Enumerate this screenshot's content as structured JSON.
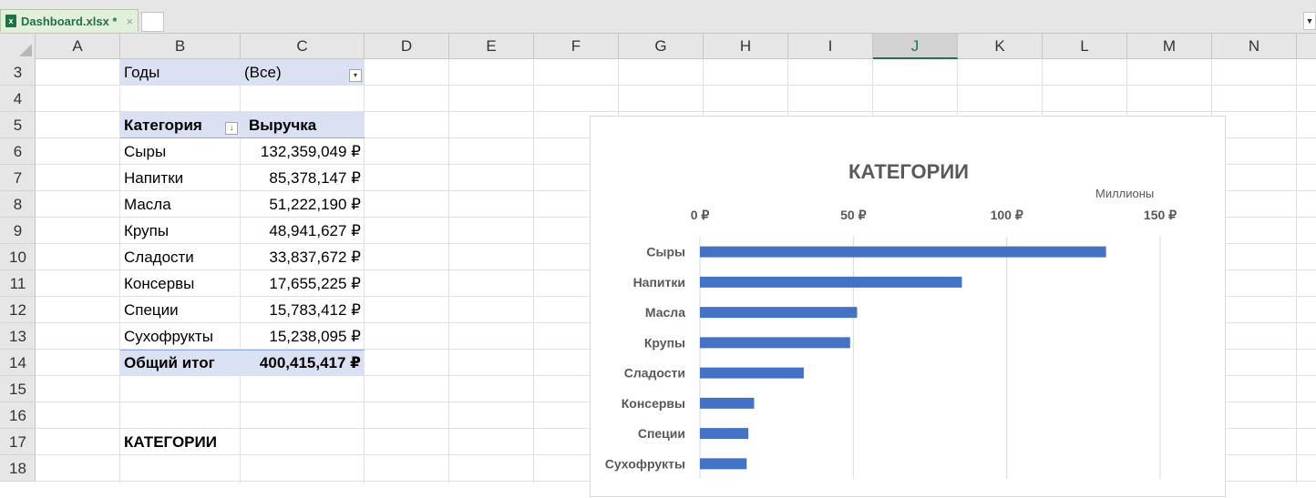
{
  "file_tab": {
    "name": "Dashboard.xlsx *",
    "icon": "excel-file-icon",
    "close": "×"
  },
  "columns": [
    "A",
    "B",
    "C",
    "D",
    "E",
    "F",
    "G",
    "H",
    "I",
    "J",
    "K",
    "L",
    "M",
    "N"
  ],
  "selected_column": "J",
  "rows": [
    "3",
    "4",
    "5",
    "6",
    "7",
    "8",
    "9",
    "10",
    "11",
    "12",
    "13",
    "14",
    "15",
    "16",
    "17",
    "18"
  ],
  "pivot": {
    "filter_label": "Годы",
    "filter_value": "(Все)",
    "header_category": "Категория",
    "header_revenue": "Выручка",
    "rows": [
      {
        "category": "Сыры",
        "revenue": "132,359,049 ₽"
      },
      {
        "category": "Напитки",
        "revenue": "85,378,147 ₽"
      },
      {
        "category": "Масла",
        "revenue": "51,222,190 ₽"
      },
      {
        "category": "Крупы",
        "revenue": "48,941,627 ₽"
      },
      {
        "category": "Сладости",
        "revenue": "33,837,672 ₽"
      },
      {
        "category": "Консервы",
        "revenue": "17,655,225 ₽"
      },
      {
        "category": "Специи",
        "revenue": "15,783,412 ₽"
      },
      {
        "category": "Сухофрукты",
        "revenue": "15,238,095 ₽"
      }
    ],
    "total_label": "Общий итог",
    "total_value": "400,415,417 ₽"
  },
  "section_label": "КАТЕГОРИИ",
  "colors": {
    "bar": "#4472c4",
    "band": "#d9e1f2",
    "accent": "#217346"
  },
  "chart_data": {
    "type": "bar",
    "orientation": "horizontal",
    "title": "КАТЕГОРИИ",
    "units_label": "Миллионы",
    "categories": [
      "Сыры",
      "Напитки",
      "Масла",
      "Крупы",
      "Сладости",
      "Консервы",
      "Специи",
      "Сухофрукты"
    ],
    "values": [
      132.36,
      85.38,
      51.22,
      48.94,
      33.84,
      17.66,
      15.78,
      15.24
    ],
    "xlim": [
      0,
      150
    ],
    "ticks": [
      0,
      50,
      100,
      150
    ],
    "tick_labels": [
      "0 ₽",
      "50 ₽",
      "100 ₽",
      "150 ₽"
    ],
    "axis_position": "top",
    "grid": true,
    "legend": "none"
  }
}
